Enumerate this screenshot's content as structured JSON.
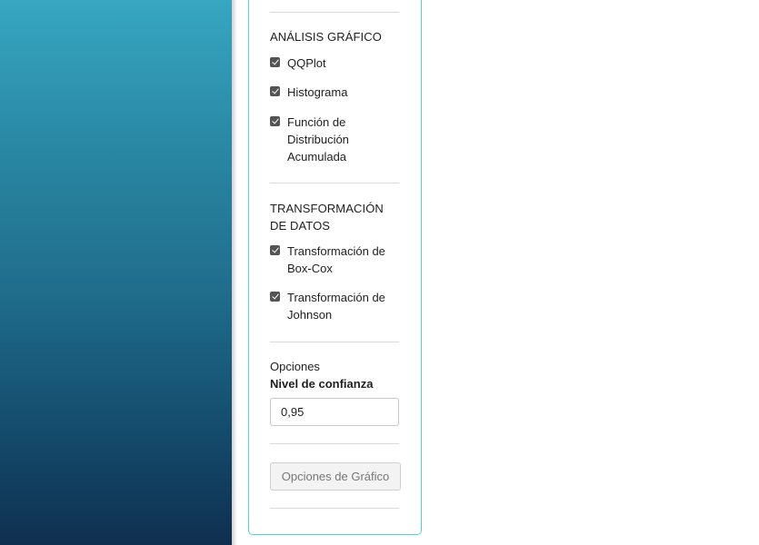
{
  "colors": {
    "sidebar_gradient_top": "#37a6c1",
    "sidebar_gradient_bottom": "#0f2f4f",
    "panel_border": "#52d3cf",
    "checkbox": "#545454"
  },
  "graphic_analysis": {
    "heading": "ANÁLISIS GRÁFICO",
    "items": [
      {
        "label": "QQPlot",
        "checked": true
      },
      {
        "label": "Histograma",
        "checked": true
      },
      {
        "label": "Función de Distribución Acumulada",
        "checked": true
      }
    ]
  },
  "data_transformation": {
    "heading": "TRANSFORMACIÓN DE DATOS",
    "items": [
      {
        "label": "Transformación de Box-Cox",
        "checked": true
      },
      {
        "label": "Transformación de Johnson",
        "checked": true
      }
    ]
  },
  "options": {
    "heading": "Opciones",
    "confidence_label": "Nivel de confianza",
    "confidence_value": "0,95"
  },
  "chart_options_button": "Opciones de Gráfico"
}
